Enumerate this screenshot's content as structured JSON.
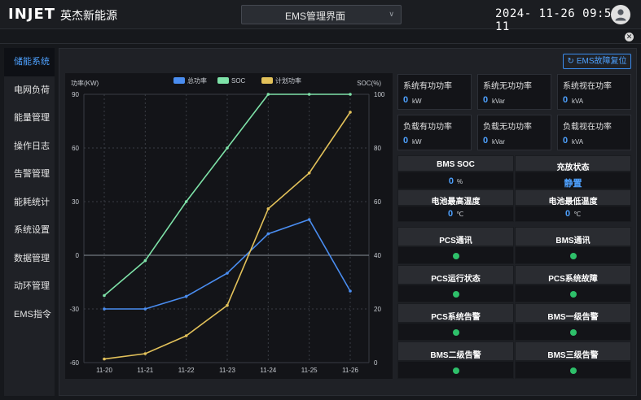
{
  "header": {
    "logo": "INJET",
    "company": "英杰新能源",
    "selector": "EMS管理界面",
    "clock": "2024- 11-26  09:55: 11"
  },
  "sidebar": {
    "items": [
      {
        "label": "储能系统",
        "active": true
      },
      {
        "label": "电网负荷"
      },
      {
        "label": "能量管理"
      },
      {
        "label": "操作日志"
      },
      {
        "label": "告警管理"
      },
      {
        "label": "能耗统计"
      },
      {
        "label": "系统设置"
      },
      {
        "label": "数据管理"
      },
      {
        "label": "动环管理"
      },
      {
        "label": "EMS指令"
      }
    ]
  },
  "fault_reset": "EMS故障复位",
  "system_cards": [
    {
      "title": "系统有功功率",
      "value": "0",
      "unit": "kW"
    },
    {
      "title": "系统无功功率",
      "value": "0",
      "unit": "kVar"
    },
    {
      "title": "系统视在功率",
      "value": "0",
      "unit": "kVA"
    },
    {
      "title": "负载有功功率",
      "value": "0",
      "unit": "kW"
    },
    {
      "title": "负载无功功率",
      "value": "0",
      "unit": "kVar"
    },
    {
      "title": "负载视在功率",
      "value": "0",
      "unit": "kVA"
    }
  ],
  "bms": {
    "soc_label": "BMS SOC",
    "soc_value": "0",
    "soc_unit": "%",
    "charge_label": "充放状态",
    "charge_value": "静置",
    "max_temp_label": "电池最高温度",
    "max_temp_value": "0",
    "max_temp_unit": "℃",
    "min_temp_label": "电池最低温度",
    "min_temp_value": "0",
    "min_temp_unit": "℃"
  },
  "status": [
    {
      "label": "PCS通讯",
      "color": "#2ec06a"
    },
    {
      "label": "BMS通讯",
      "color": "#2ec06a"
    },
    {
      "label": "PCS运行状态",
      "color": "#2ec06a"
    },
    {
      "label": "PCS系统故障",
      "color": "#2ec06a"
    },
    {
      "label": "PCS系统告警",
      "color": "#2ec06a"
    },
    {
      "label": "BMS一级告警",
      "color": "#2ec06a"
    },
    {
      "label": "BMS二级告警",
      "color": "#2ec06a"
    },
    {
      "label": "BMS三级告警",
      "color": "#2ec06a"
    }
  ],
  "chart_data": {
    "type": "line",
    "categories": [
      "11-20",
      "11-21",
      "11-22",
      "11-23",
      "11-24",
      "11-25",
      "11-26"
    ],
    "ylabel_left": "功率(KW)",
    "ylabel_right": "SOC(%)",
    "ylim_left": [
      -60,
      90
    ],
    "ylim_right": [
      0,
      100
    ],
    "left_ticks": [
      90,
      60,
      30,
      0,
      -30,
      -60
    ],
    "right_ticks": [
      100,
      80,
      60,
      40,
      20,
      0
    ],
    "grid": true,
    "legend": "top-center",
    "series": [
      {
        "name": "总功率",
        "axis": "left",
        "color": "#4a8df0",
        "values": [
          -30,
          -30,
          -23,
          -10,
          12,
          20,
          -20
        ]
      },
      {
        "name": "SOC",
        "axis": "right",
        "color": "#7ee2a8",
        "values": [
          25,
          38,
          60,
          80,
          100,
          100,
          100
        ]
      },
      {
        "name": "计划功率",
        "axis": "left",
        "color": "#e2c15a",
        "values": [
          -58,
          -55,
          -45,
          -28,
          26,
          46,
          80
        ]
      }
    ]
  }
}
